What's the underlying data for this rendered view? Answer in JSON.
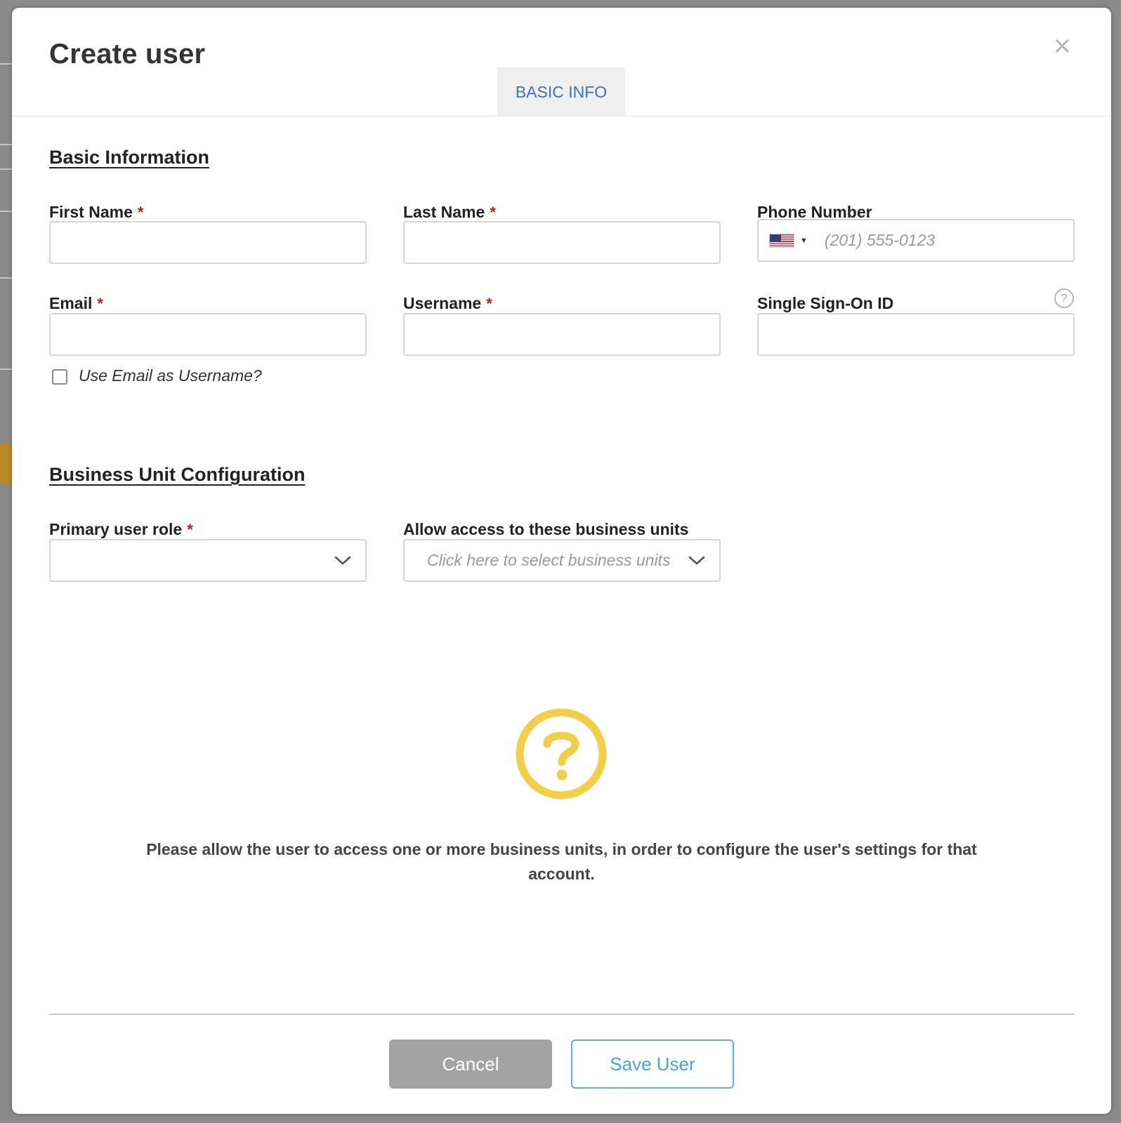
{
  "modal": {
    "title": "Create user",
    "close_glyph": "×",
    "tab_label": "BASIC INFO"
  },
  "basic_info": {
    "section_title": "Basic Information",
    "first_name": {
      "label": "First Name",
      "value": ""
    },
    "last_name": {
      "label": "Last Name",
      "value": ""
    },
    "phone": {
      "label": "Phone Number",
      "placeholder": "(201) 555-0123",
      "country_icon": "us-flag-icon"
    },
    "email": {
      "label": "Email",
      "value": ""
    },
    "username": {
      "label": "Username",
      "value": ""
    },
    "sso": {
      "label": "Single Sign-On ID",
      "help_glyph": "?",
      "value": ""
    },
    "use_email_checkbox": {
      "label": "Use Email as Username?",
      "checked": false
    },
    "required_marker": "*"
  },
  "business_unit": {
    "section_title": "Business Unit Configuration",
    "primary_role": {
      "label": "Primary user role",
      "value": ""
    },
    "allow_access": {
      "label": "Allow access to these business units",
      "placeholder": "Click here to select business units"
    },
    "info_icon": "question-circle-icon",
    "info_color": "#f2cf47",
    "info_text": "Please allow the user to access one or more business units, in order to configure the user's settings for that account."
  },
  "footer": {
    "cancel_label": "Cancel",
    "save_label": "Save User"
  },
  "colors": {
    "accent_blue": "#3b73b9",
    "save_blue": "#4aa3e0",
    "required_red": "#c21a1a",
    "cancel_gray": "#a3a3a3"
  }
}
